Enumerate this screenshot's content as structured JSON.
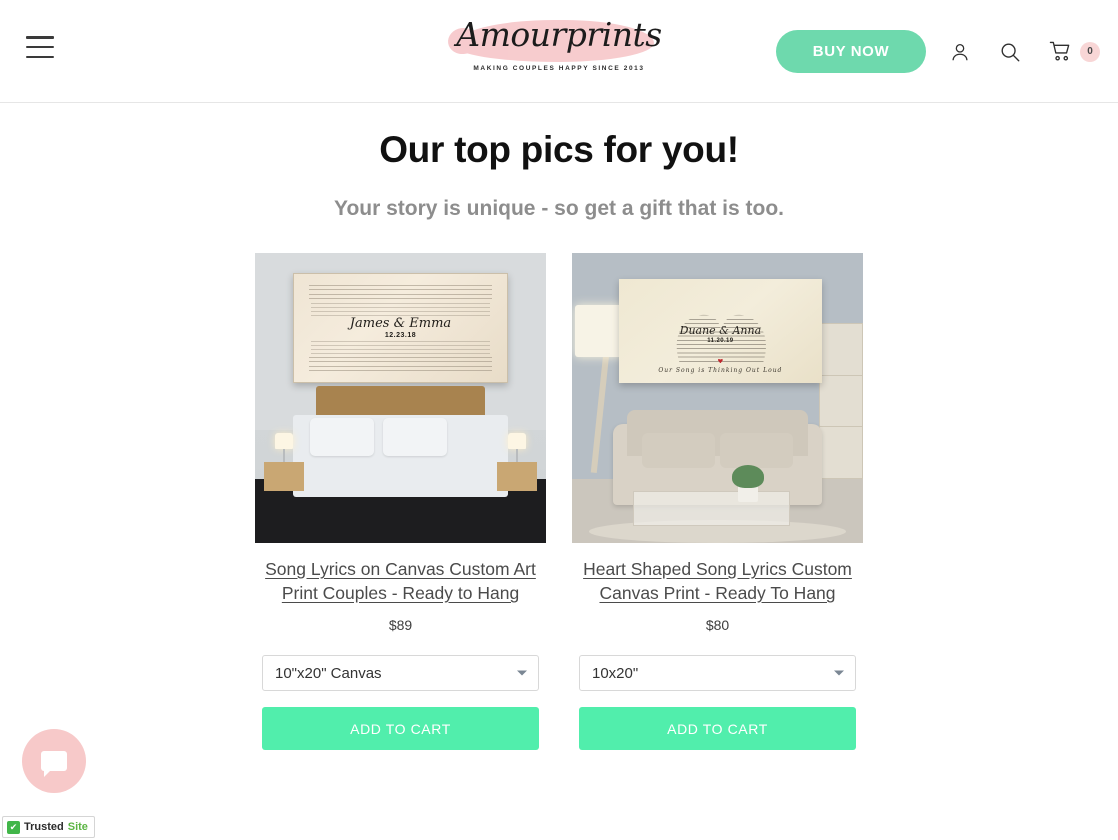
{
  "header": {
    "menu_icon": "hamburger-menu-icon",
    "logo": {
      "brand": "Amourprints",
      "tagline": "MAKING COUPLES HAPPY SINCE 2013"
    },
    "buy_now_label": "BUY NOW",
    "account_icon": "user-account-icon",
    "search_icon": "search-icon",
    "cart_icon": "shopping-cart-icon",
    "cart_count": "0"
  },
  "main": {
    "title": "Our top pics for you!",
    "subtitle": "Your story is unique - so get a gift that is too.",
    "products": [
      {
        "title": "Song Lyrics on Canvas Custom Art Print Couples - Ready to Hang",
        "price": "$89",
        "variant": "10\"x20\" Canvas",
        "add_to_cart_label": "ADD TO CART",
        "image_alt": "bedroom-canvas-preview",
        "canvas_names": "James & Emma",
        "canvas_date": "12.23.18"
      },
      {
        "title": "Heart Shaped Song Lyrics Custom Canvas Print - Ready To Hang",
        "price": "$80",
        "variant": "10x20\"",
        "add_to_cart_label": "ADD TO CART",
        "image_alt": "living-room-canvas-preview",
        "canvas_names": "Duane & Anna",
        "canvas_date": "11.20.19",
        "canvas_subtitle": "Our Song is Thinking Out Loud"
      }
    ]
  },
  "widgets": {
    "chat_icon": "chat-bubble-icon",
    "trusted_site": {
      "check_glyph": "✔",
      "word_one": "Trusted",
      "word_two": "Site"
    }
  },
  "colors": {
    "mint": "#6ed9ad",
    "mint_bright": "#51eeac",
    "pink": "#f6c3c6",
    "badge_pink": "#f8d6d6"
  }
}
